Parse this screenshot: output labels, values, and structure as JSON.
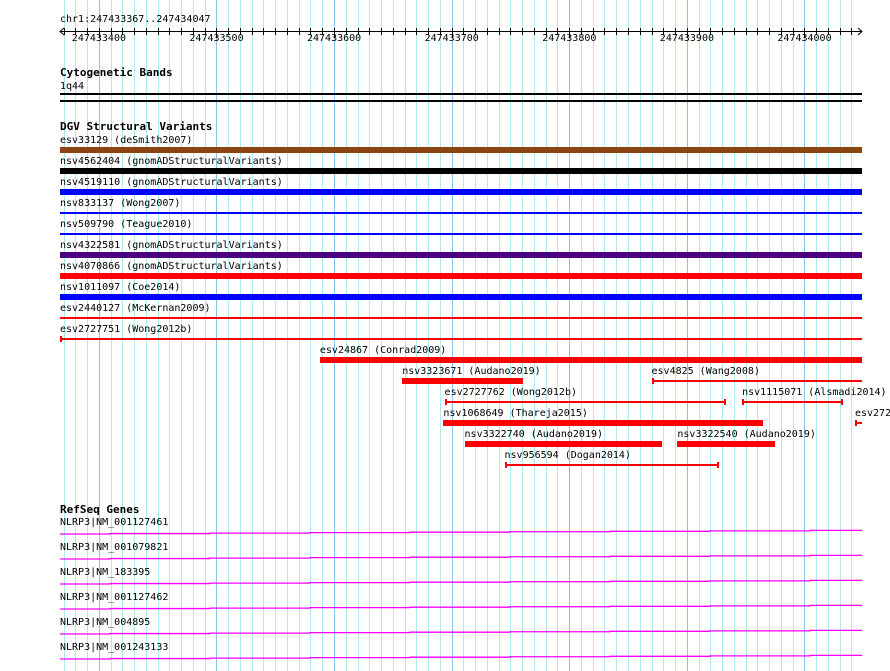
{
  "view": {
    "chrom": "chr1",
    "start": 247433367,
    "end": 247434047,
    "location_label": "chr1:247433367..247434047"
  },
  "ruler": {
    "tick_labels": [
      "247433400",
      "247433500",
      "247433600",
      "247433700",
      "247433800",
      "247433900",
      "247434000"
    ]
  },
  "cytobands": {
    "title": "Cytogenetic Bands",
    "band": "1q44"
  },
  "dgv": {
    "title": "DGV Structural Variants",
    "variants": [
      {
        "label": "esv33129 (deSmith2007)",
        "row": 0,
        "start": 247433000,
        "end": 247435000,
        "style": "thick",
        "color": "#8b4513"
      },
      {
        "label": "nsv4562404 (gnomADStructuralVariants)",
        "row": 1,
        "start": 247433000,
        "end": 247435000,
        "style": "thick",
        "color": "#000000"
      },
      {
        "label": "nsv4519110 (gnomADStructuralVariants)",
        "row": 2,
        "start": 247433000,
        "end": 247435000,
        "style": "thick",
        "color": "#0000ff"
      },
      {
        "label": "nsv833137 (Wong2007)",
        "row": 3,
        "start": 247433000,
        "end": 247435000,
        "style": "thin",
        "color": "#0000ff"
      },
      {
        "label": "nsv509790 (Teague2010)",
        "row": 4,
        "start": 247433000,
        "end": 247435000,
        "style": "thin",
        "color": "#0000ff"
      },
      {
        "label": "nsv4322581 (gnomADStructuralVariants)",
        "row": 5,
        "start": 247433000,
        "end": 247435000,
        "style": "thick",
        "color": "#4b0082"
      },
      {
        "label": "nsv4070866 (gnomADStructuralVariants)",
        "row": 6,
        "start": 247433000,
        "end": 247435000,
        "style": "thick",
        "color": "#ff0000"
      },
      {
        "label": "nsv1011097 (Coe2014)",
        "row": 7,
        "start": 247433000,
        "end": 247435000,
        "style": "thick",
        "color": "#0000ff"
      },
      {
        "label": "esv2440127 (McKernan2009)",
        "row": 8,
        "start": 247433000,
        "end": 247435000,
        "style": "thin",
        "color": "#ff0000"
      },
      {
        "label": "esv2727751 (Wong2012b)",
        "row": 9,
        "start": 247433367,
        "end": 247435000,
        "style": "thin",
        "color": "#ff0000"
      },
      {
        "label": "esv24867 (Conrad2009)",
        "row": 10,
        "start": 247433588,
        "end": 247435000,
        "style": "thick",
        "color": "#ff0000"
      },
      {
        "label": "nsv3323671 (Audano2019)",
        "row": 11,
        "start": 247433658,
        "end": 247433761,
        "style": "thick",
        "color": "#ff0000"
      },
      {
        "label": "esv4825 (Wang2008)",
        "row": 11,
        "start": 247433870,
        "end": 247435000,
        "style": "thin",
        "color": "#ff0000"
      },
      {
        "label": "esv2727762 (Wong2012b)",
        "row": 12,
        "start": 247433694,
        "end": 247433933,
        "style": "thin",
        "color": "#ff0000"
      },
      {
        "label": "nsv1115071 (Alsmadi2014)",
        "row": 12,
        "start": 247433947,
        "end": 247434033,
        "style": "thin",
        "color": "#ff0000"
      },
      {
        "label": "nsv1068649 (Thareja2015)",
        "row": 13,
        "start": 247433693,
        "end": 247433965,
        "style": "thick",
        "color": "#ff0000"
      },
      {
        "label": "esv272",
        "row": 13,
        "start": 247434043,
        "end": 247435000,
        "style": "thin",
        "color": "#ff0000"
      },
      {
        "label": "nsv3322740 (Audano2019)",
        "row": 14,
        "start": 247433711,
        "end": 247433879,
        "style": "thick",
        "color": "#ff0000"
      },
      {
        "label": "nsv3322540 (Audano2019)",
        "row": 14,
        "start": 247433892,
        "end": 247433975,
        "style": "thick",
        "color": "#ff0000"
      },
      {
        "label": "nsv956594 (Dogan2014)",
        "row": 15,
        "start": 247433745,
        "end": 247433927,
        "style": "thin",
        "color": "#ff0000"
      }
    ]
  },
  "refseq": {
    "title": "RefSeq Genes",
    "color": "#ff00ff",
    "genes": [
      "NLRP3|NM_001127461",
      "NLRP3|NM_001079821",
      "NLRP3|NM_183395",
      "NLRP3|NM_001127462",
      "NLRP3|NM_004895",
      "NLRP3|NM_001243133"
    ]
  }
}
